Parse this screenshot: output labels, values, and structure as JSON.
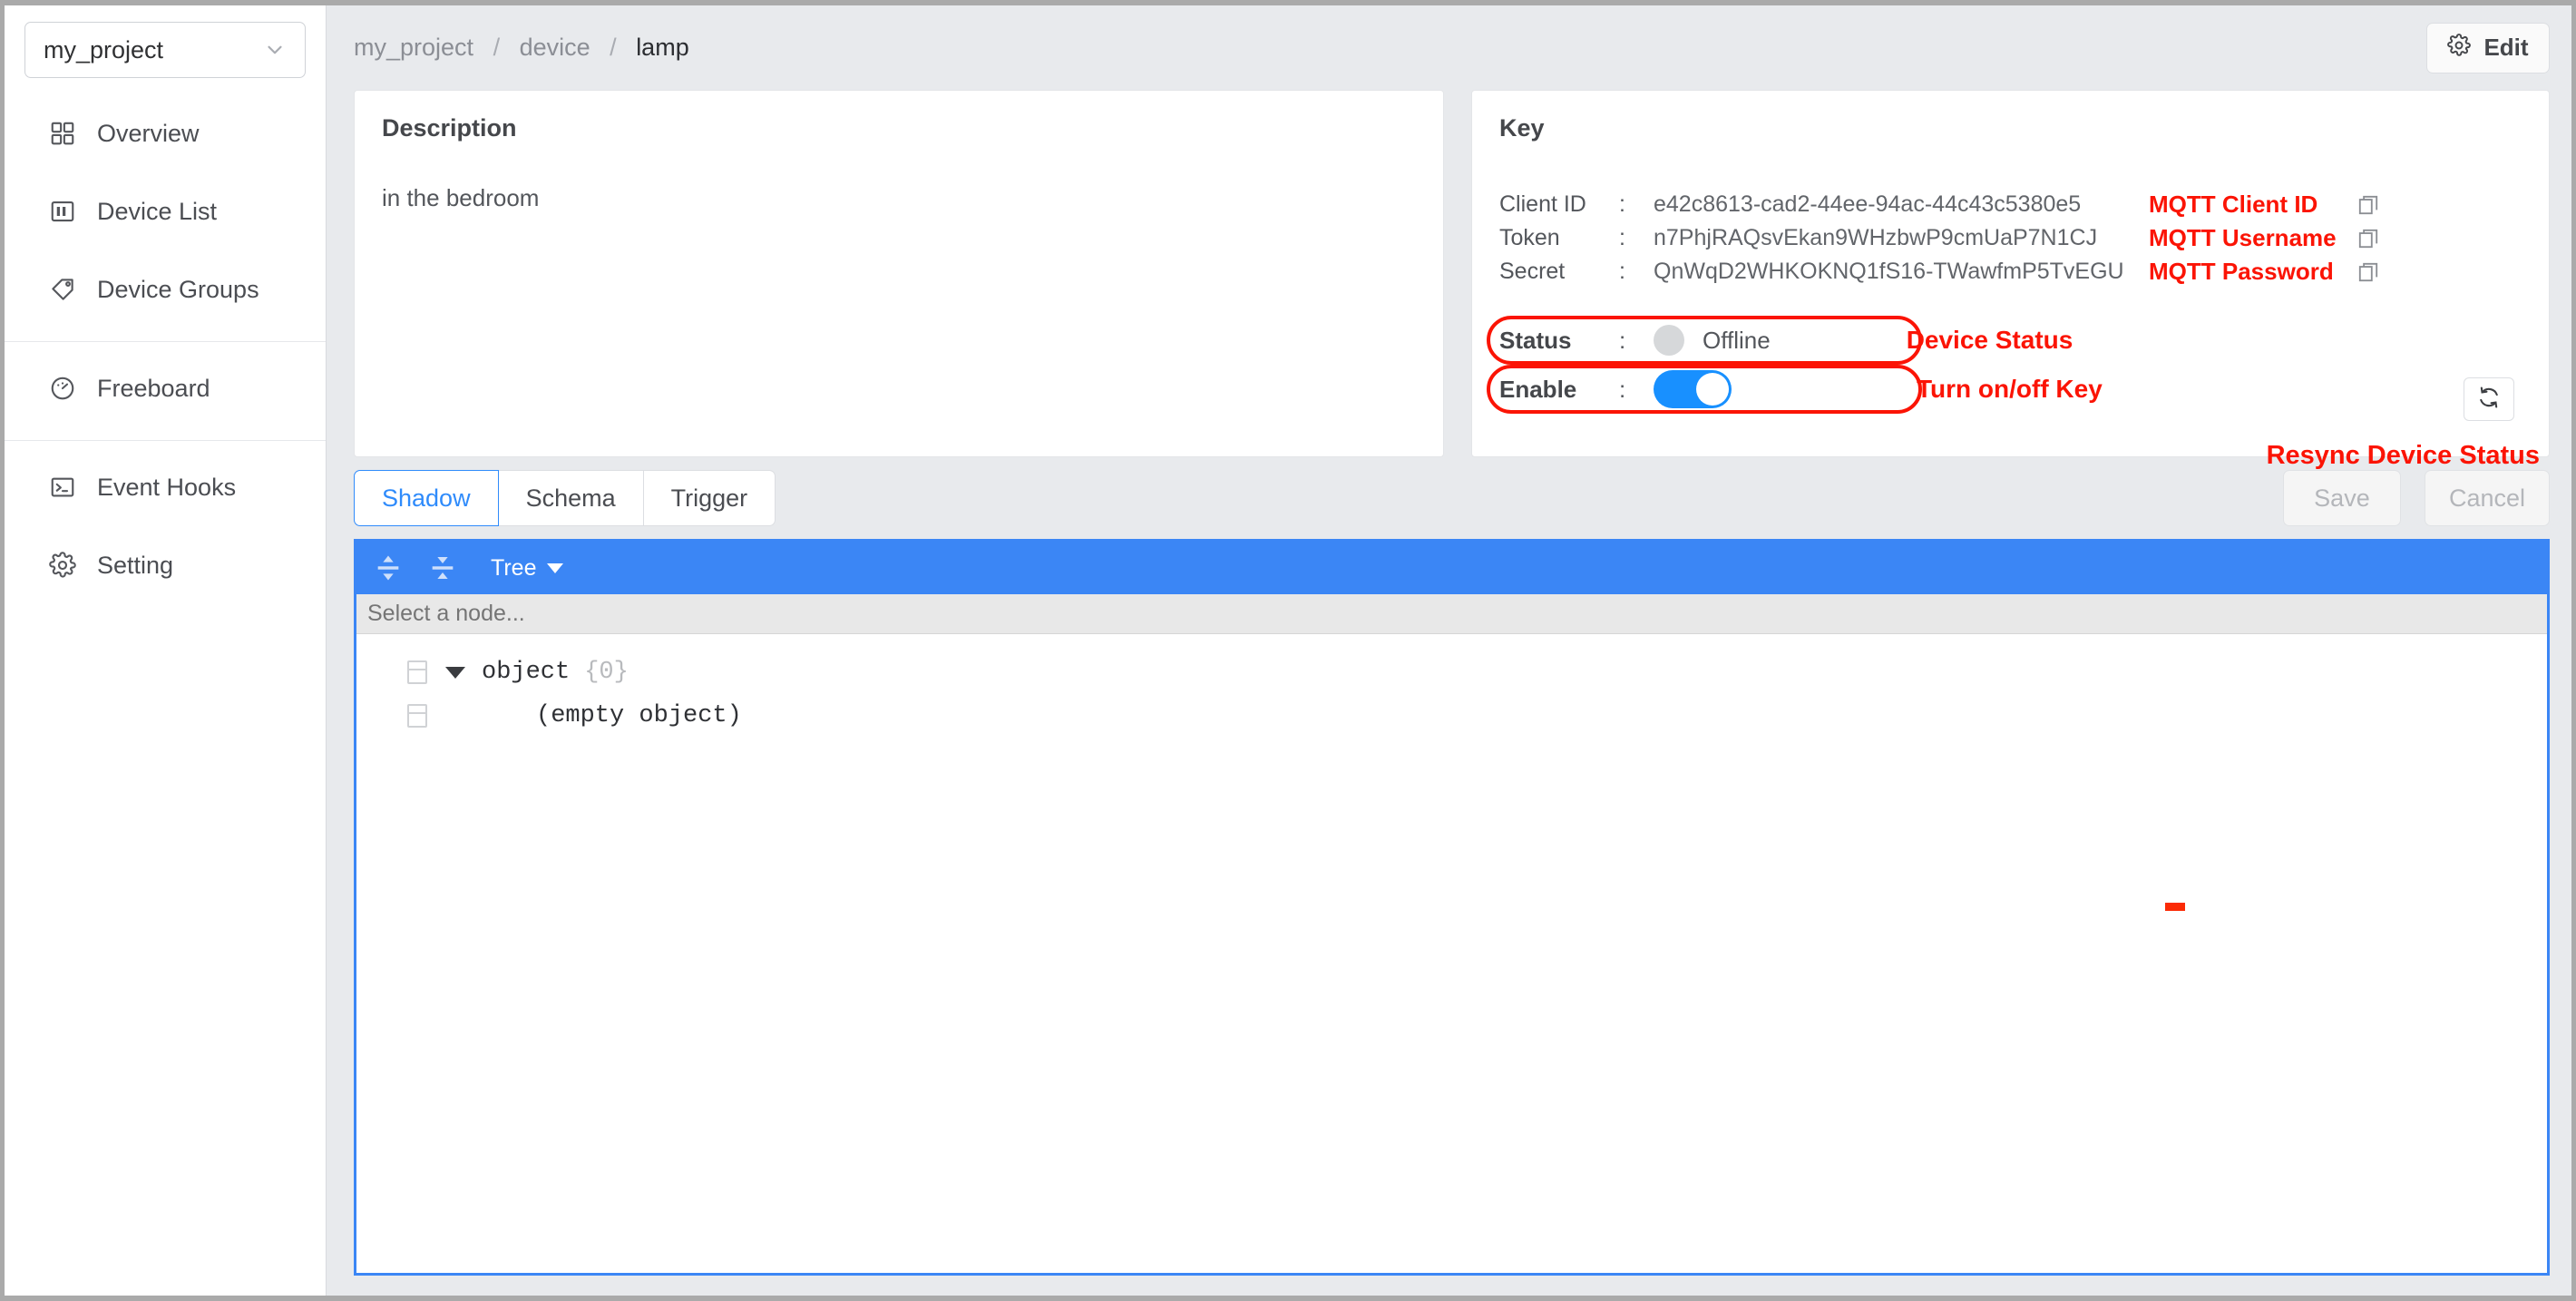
{
  "sidebar": {
    "project_selector": {
      "value": "my_project",
      "icon": "chevron-down-icon"
    },
    "groups": [
      {
        "items": [
          {
            "label": "Overview",
            "icon": "grid-icon"
          },
          {
            "label": "Device List",
            "icon": "board-icon"
          },
          {
            "label": "Device Groups",
            "icon": "tag-icon"
          }
        ]
      },
      {
        "items": [
          {
            "label": "Freeboard",
            "icon": "gauge-icon"
          }
        ]
      },
      {
        "items": [
          {
            "label": "Event Hooks",
            "icon": "terminal-icon"
          },
          {
            "label": "Setting",
            "icon": "gear-icon"
          }
        ]
      }
    ]
  },
  "topbar": {
    "breadcrumb": {
      "root": "my_project",
      "middle": "device",
      "current": "lamp",
      "separator": "/"
    },
    "edit_button": {
      "label": "Edit",
      "icon": "gear-icon"
    }
  },
  "description_panel": {
    "title": "Description",
    "body": "in the bedroom"
  },
  "key_panel": {
    "title": "Key",
    "colon": ":",
    "rows": [
      {
        "key": "Client ID",
        "value": "e42c8613-cad2-44ee-94ac-44c43c5380e5",
        "annotation": "MQTT Client ID",
        "copy_icon": "copy-icon"
      },
      {
        "key": "Token",
        "value": "n7PhjRAQsvEkan9WHzbwP9cmUaP7N1CJ",
        "annotation": "MQTT Username",
        "copy_icon": "copy-icon"
      },
      {
        "key": "Secret",
        "value": "QnWqD2WHKOKNQ1fS16-TWawfmP5TvEGU",
        "annotation": "MQTT Password",
        "copy_icon": "copy-icon"
      }
    ],
    "status": {
      "key": "Status",
      "value": "Offline",
      "annotation": "Device Status",
      "indicator_color": "#d6d8da"
    },
    "enable": {
      "key": "Enable",
      "state": "on",
      "annotation": "Turn on/off Key",
      "switch_color": "#1890ff"
    },
    "resync": {
      "icon": "refresh-icon",
      "annotation": "Resync Device Status"
    },
    "annotation_color": "#fb1405"
  },
  "tabs": [
    {
      "label": "Shadow",
      "active": true
    },
    {
      "label": "Schema",
      "active": false
    },
    {
      "label": "Trigger",
      "active": false
    }
  ],
  "actions": {
    "save_label": "Save",
    "cancel_label": "Cancel"
  },
  "editor": {
    "accent_color": "#3b86f5",
    "menu": {
      "expand_icon": "expand-all-icon",
      "collapse_icon": "collapse-all-icon",
      "mode_label": "Tree",
      "mode_caret": "caret-down-icon"
    },
    "search_placeholder": "Select a node...",
    "search_value": "",
    "tree": [
      {
        "label": "object",
        "count": "{0}",
        "expanded": true
      },
      {
        "label": "(empty object)"
      }
    ]
  }
}
